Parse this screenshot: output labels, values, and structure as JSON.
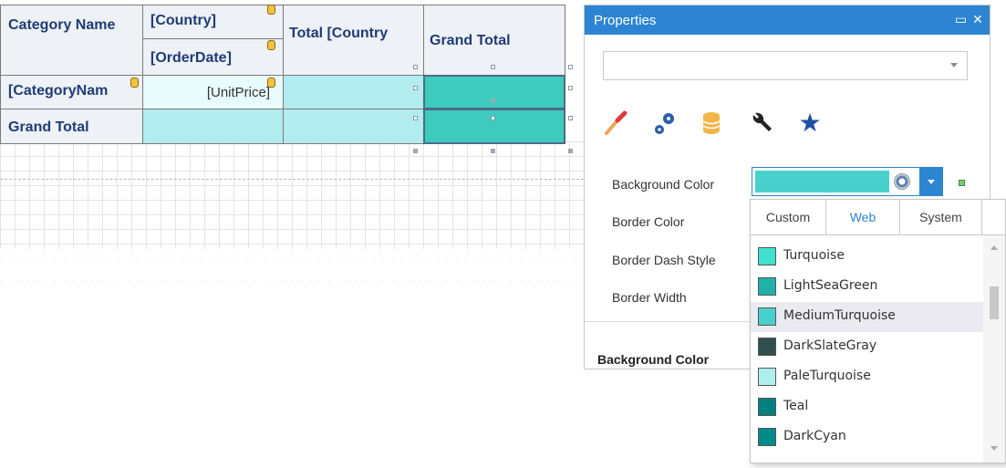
{
  "pivot": {
    "header_category": "Category Name",
    "header_country": "[Country]",
    "header_orderdate": "[OrderDate]",
    "header_total_country": "Total [Country",
    "header_grand_total": "Grand Total",
    "row_category": "[CategoryNam",
    "cell_unitprice": "[UnitPrice]",
    "row_grand_total": "Grand Total",
    "colors": {
      "header_bg": "#eef1f5",
      "cell_cyan": "#b2ecee",
      "cell_teal": "#3ecbbe",
      "text": "#1f3b78"
    }
  },
  "properties": {
    "title": "Properties",
    "combo_value": "",
    "tab_icons": [
      "paintbrush-icon",
      "gears-icon",
      "database-icon",
      "wrench-icon",
      "star-icon"
    ],
    "labels": {
      "background_color": "Background Color",
      "border_color": "Border Color",
      "border_dash_style": "Border Dash Style",
      "border_width": "Border Width"
    },
    "background_color_value": "#48d1cc",
    "section_label": "Background Color"
  },
  "color_dropdown": {
    "tabs": [
      "Custom",
      "Web",
      "System"
    ],
    "active_tab": "Web",
    "items": [
      {
        "name": "Turquoise",
        "color": "#40e0d0"
      },
      {
        "name": "LightSeaGreen",
        "color": "#20b2aa"
      },
      {
        "name": "MediumTurquoise",
        "color": "#48d1cc",
        "highlighted": true
      },
      {
        "name": "DarkSlateGray",
        "color": "#2f4f4f"
      },
      {
        "name": "PaleTurquoise",
        "color": "#afeeee"
      },
      {
        "name": "Teal",
        "color": "#008080"
      },
      {
        "name": "DarkCyan",
        "color": "#008b8b"
      }
    ]
  }
}
